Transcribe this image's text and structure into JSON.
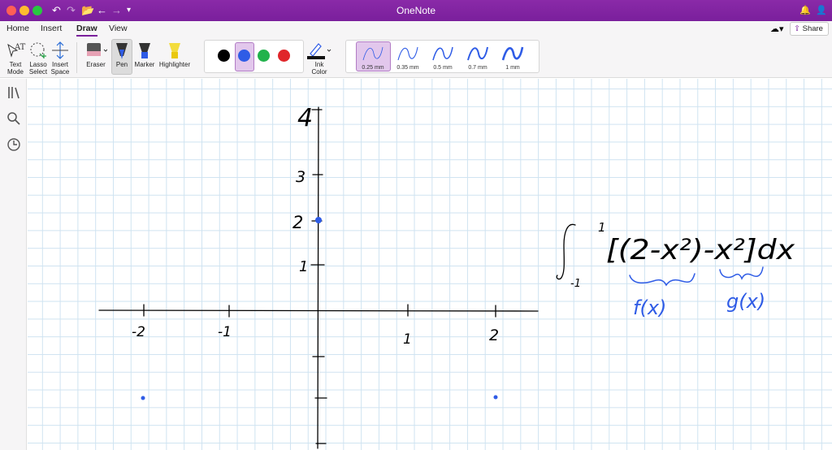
{
  "window": {
    "title": "OneNote"
  },
  "tabs": [
    {
      "label": "Home"
    },
    {
      "label": "Insert"
    },
    {
      "label": "Draw"
    },
    {
      "label": "View"
    }
  ],
  "share": {
    "label": "Share"
  },
  "toolbar": {
    "text_mode": {
      "line1": "Text",
      "line2": "Mode"
    },
    "lasso_select": {
      "line1": "Lasso",
      "line2": "Select"
    },
    "insert_space": {
      "line1": "Insert",
      "line2": "Space"
    },
    "eraser": "Eraser",
    "pen": "Pen",
    "marker": "Marker",
    "highlighter": "Highlighter",
    "ink_color": {
      "line1": "Ink",
      "line2": "Color"
    }
  },
  "colors": {
    "titlebar": "#7a1f9c",
    "black": "#000000",
    "blue": "#2f5ce6",
    "green": "#22b24c",
    "red": "#e0262a",
    "ink": "#2f5ce6"
  },
  "thickness": [
    {
      "label": "0.25 mm"
    },
    {
      "label": "0.35 mm"
    },
    {
      "label": "0.5 mm"
    },
    {
      "label": "0.7 mm"
    },
    {
      "label": "1 mm"
    }
  ],
  "handwriting": {
    "y_ticks": [
      "4",
      "3",
      "2",
      "1"
    ],
    "x_ticks": [
      "-2",
      "-1",
      "1",
      "2"
    ],
    "integral_upper": "1",
    "integral_lower": "-1",
    "integrand": "[(2-x²)-x²]dx",
    "f_label": "f(x)",
    "g_label": "g(x)"
  }
}
